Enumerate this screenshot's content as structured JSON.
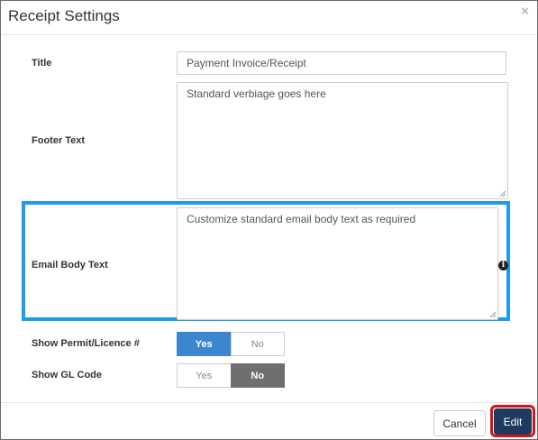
{
  "dialog": {
    "title": "Receipt Settings",
    "close_glyph": "×"
  },
  "fields": {
    "title": {
      "label": "Title",
      "value": "Payment Invoice/Receipt"
    },
    "footer_text": {
      "label": "Footer Text",
      "value": "Standard verbiage goes here"
    },
    "email_body_text": {
      "label": "Email Body Text",
      "value": "Customize standard email body text as required"
    },
    "show_permit": {
      "label": "Show Permit/Licence #",
      "yes": "Yes",
      "no": "No",
      "selected": "Yes"
    },
    "show_gl_code": {
      "label": "Show GL Code",
      "yes": "Yes",
      "no": "No",
      "selected": "No"
    }
  },
  "icons": {
    "info": "info-icon",
    "close": "close-icon"
  },
  "colors": {
    "highlight": "#1e9be9",
    "yes_active": "#3a87cf",
    "no_active": "#6f6f6f",
    "edit_button": "#1f3a5f",
    "edit_outline": "#d0161c"
  },
  "footer": {
    "cancel_label": "Cancel",
    "edit_label": "Edit"
  }
}
